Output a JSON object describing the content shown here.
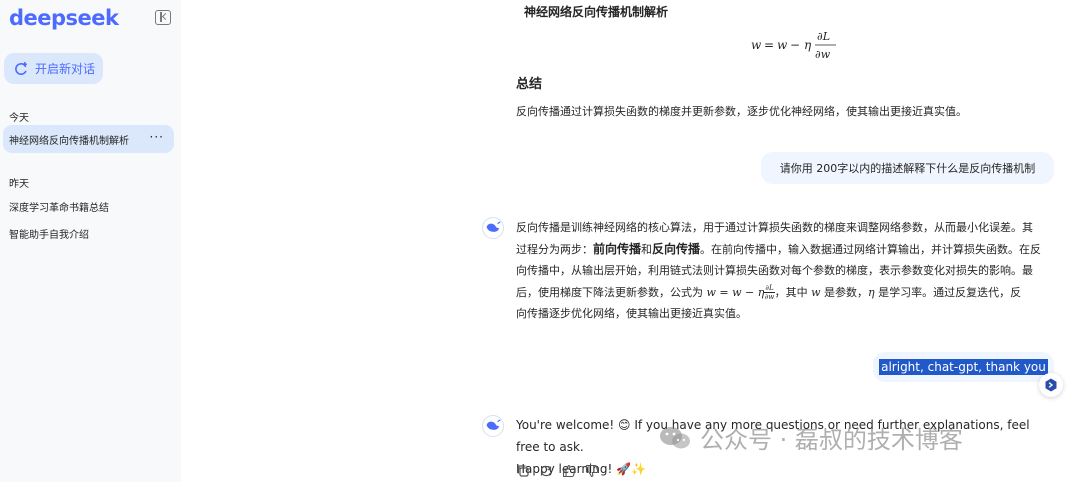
{
  "sidebar": {
    "logo": "deepseek",
    "new_chat_label": "开启新对话",
    "today_label": "今天",
    "today_items": [
      {
        "label": "神经网络反向传播机制解析",
        "active": true,
        "more": "···"
      }
    ],
    "yesterday_label": "昨天",
    "yesterday_items": [
      {
        "label": "深度学习革命书籍总结"
      },
      {
        "label": "智能助手自我介绍"
      }
    ]
  },
  "chat": {
    "previous_answer": {
      "heading": "神经网络反向传播机制解析",
      "formula": "w = w − η ∂L/∂w",
      "summary_title": "总结",
      "summary_text": "反向传播通过计算损失函数的梯度并更新参数，逐步优化神经网络，使其输出更接近真实值。"
    },
    "user_message_1": "请你用 200字以内的描述解释下什么是反向传播机制",
    "answer": {
      "line1": "反向传播是训练神经网络的核心算法，用于通过计算损失函数的梯度来调整网络参数，从而最小化误差。其",
      "line2_prefix": "过程分为两步：",
      "bold1": "前向传播",
      "and": "和",
      "bold2": "反向传播",
      "line2_suffix": "。在前向传播中，输入数据通过网络计算输出，并计算损失函数。在反",
      "line3": "向传播中，从输出层开始，利用链式法则计算损失函数对每个参数的梯度，表示参数变化对损失的影响。最",
      "line4_prefix": "后，使用梯度下降法更新参数，公式为",
      "formula_lhs": "w = w − η",
      "frac_num": "∂L",
      "frac_den": "∂w",
      "line4_mid": "，其中",
      "var_w": "w",
      "line4_mid2": "是参数，",
      "var_eta": "η",
      "line4_suffix": "是学习率。通过反复迭代，反",
      "line5": "向传播逐步优化网络，使其输出更接近真实值。"
    },
    "user_message_2": "alright,  chat-gpt, thank you",
    "reply": {
      "line1": "You're welcome! 😊 If you have any more questions or need further explanations, feel free to ask.",
      "line2": "Happy learning! 🚀✨"
    }
  },
  "watermark": "公众号 · 磊叔的技术博客",
  "colors": {
    "brand": "#4d6bfe",
    "sidebar_bg": "#f8f9fb",
    "active_bg": "#dbe8fc",
    "bubble_bg": "#eff6ff",
    "selection": "#2259c9"
  },
  "icons": [
    "collapse-sidebar-icon",
    "new-chat-icon",
    "deepseek-whale-icon",
    "copy-icon",
    "regenerate-icon",
    "thumbs-up-icon",
    "thumbs-down-icon",
    "scroll-to-bottom-icon",
    "wechat-icon"
  ]
}
